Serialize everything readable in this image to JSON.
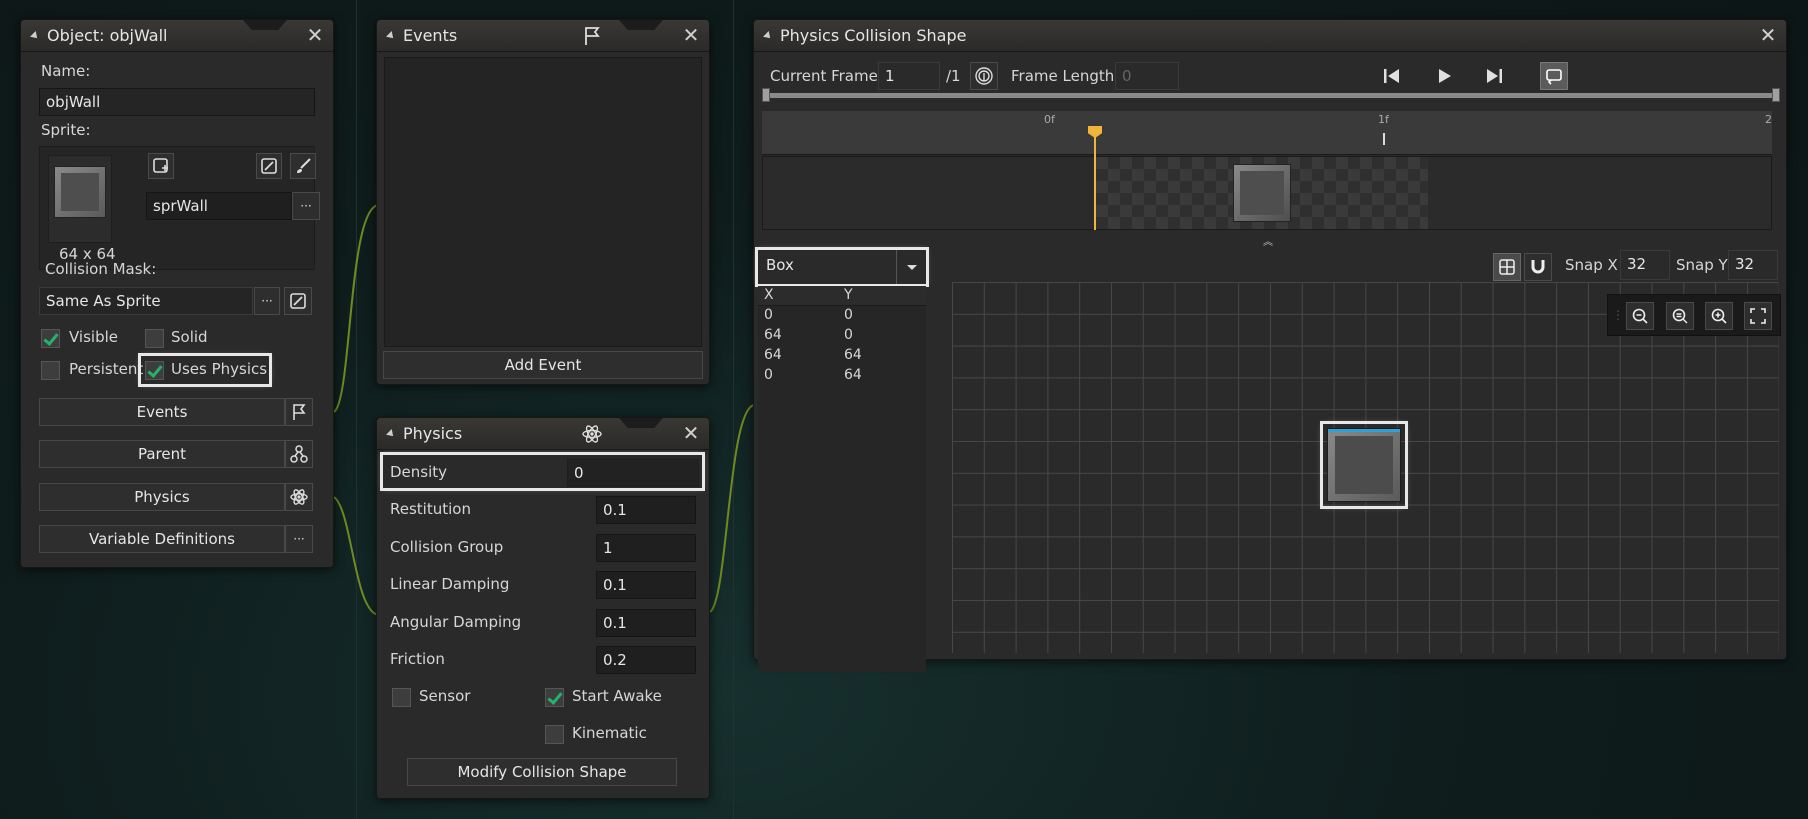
{
  "object_panel": {
    "title": "Object: objWall",
    "name_label": "Name:",
    "name_value": "objWall",
    "sprite_label": "Sprite:",
    "sprite_size": "64 x 64",
    "sprite_name": "sprWall",
    "collision_mask_label": "Collision Mask:",
    "collision_mask_value": "Same As Sprite",
    "visible_label": "Visible",
    "visible_checked": true,
    "solid_label": "Solid",
    "solid_checked": false,
    "persistent_label": "Persistent",
    "persistent_checked": false,
    "uses_physics_label": "Uses Physics",
    "uses_physics_checked": true,
    "events_button": "Events",
    "parent_button": "Parent",
    "physics_button": "Physics",
    "variable_definitions_button": "Variable Definitions",
    "ellipsis": "···"
  },
  "events_panel": {
    "title": "Events",
    "add_event_button": "Add Event"
  },
  "physics_panel": {
    "title": "Physics",
    "properties": [
      {
        "label": "Density",
        "value": "0"
      },
      {
        "label": "Restitution",
        "value": "0.1"
      },
      {
        "label": "Collision Group",
        "value": "1"
      },
      {
        "label": "Linear Damping",
        "value": "0.1"
      },
      {
        "label": "Angular Damping",
        "value": "0.1"
      },
      {
        "label": "Friction",
        "value": "0.2"
      }
    ],
    "sensor_label": "Sensor",
    "sensor_checked": false,
    "start_awake_label": "Start Awake",
    "start_awake_checked": true,
    "kinematic_label": "Kinematic",
    "kinematic_checked": false,
    "modify_button": "Modify Collision Shape"
  },
  "collision_panel": {
    "title": "Physics Collision Shape",
    "current_frame_label": "Current Frame:",
    "current_frame_value": "1",
    "frame_total": "/1",
    "frame_length_label": "Frame Length:",
    "frame_length_placeholder": "0",
    "timeline_marks": [
      "0f",
      "1f",
      "2"
    ],
    "shape_value": "Box",
    "points_headers": [
      "X",
      "Y"
    ],
    "points": [
      {
        "x": "0",
        "y": "0"
      },
      {
        "x": "64",
        "y": "0"
      },
      {
        "x": "64",
        "y": "64"
      },
      {
        "x": "0",
        "y": "64"
      }
    ],
    "snap_x_label": "Snap X",
    "snap_x_value": "32",
    "snap_y_label": "Snap Y",
    "snap_y_value": "32"
  },
  "colors": {
    "accent_green": "#24b36b",
    "connector": "#6f8a1e",
    "playhead": "#f2b53b",
    "shape_top_edge": "#2fa0d8"
  }
}
